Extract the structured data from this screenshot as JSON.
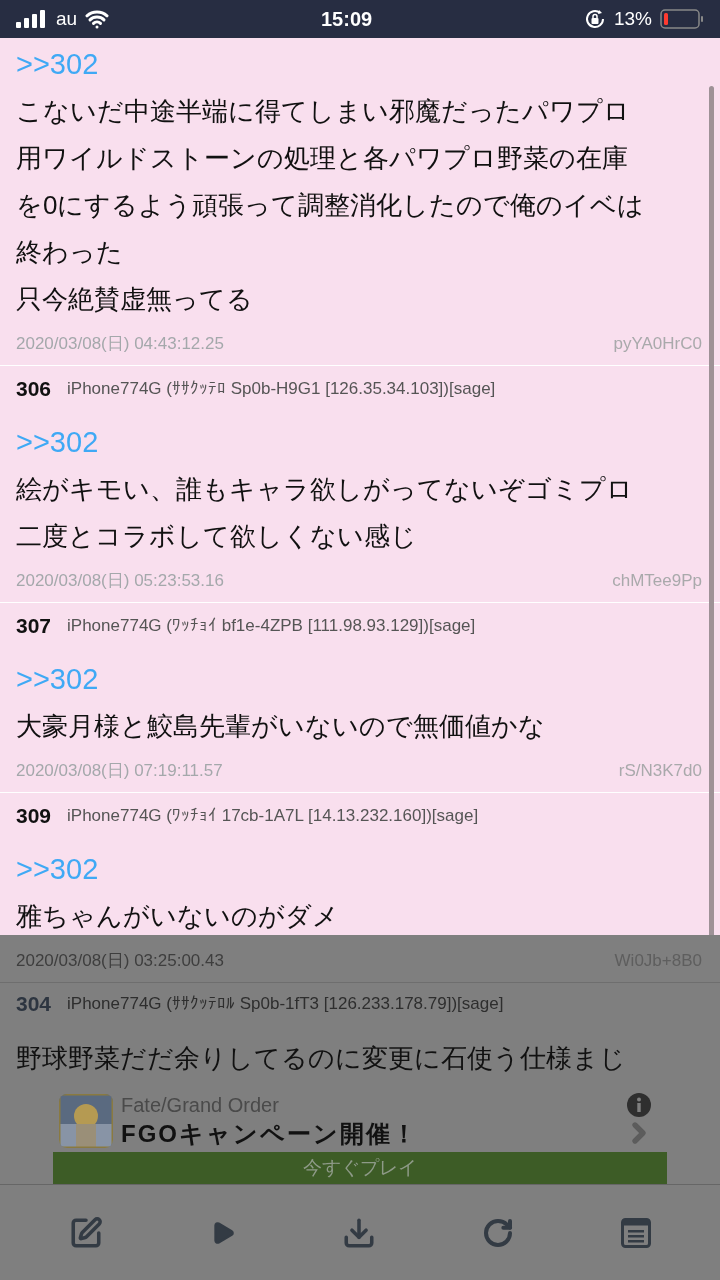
{
  "status_bar": {
    "carrier": "au",
    "time": "15:09",
    "battery": "13%"
  },
  "posts": [
    {
      "reply": ">>302",
      "lines": [
        "こないだ中途半端に得てしまい邪魔だったパワプロ",
        "用ワイルドストーンの処理と各パワプロ野菜の在庫",
        "を0にするよう頑張って調整消化したので俺のイベは",
        "終わった",
        "只今絶賛虚無ってる"
      ],
      "date": "2020/03/08(日) 04:43:12.25",
      "id": "pyYA0HrC0"
    },
    {
      "number": "306",
      "name": "iPhone774G (ｻｻｸｯﾃﾛ Sp0b-H9G1 [126.35.34.103])[sage]",
      "reply": ">>302",
      "lines": [
        "絵がキモい、誰もキャラ欲しがってないぞゴミプロ",
        "二度とコラボして欲しくない感じ"
      ],
      "date": "2020/03/08(日) 05:23:53.16",
      "id": "chMTee9Pp"
    },
    {
      "number": "307",
      "name": "iPhone774G (ﾜｯﾁｮｲ bf1e-4ZPB [111.98.93.129])[sage]",
      "reply": ">>302",
      "lines": [
        "大豪月様と鮫島先輩がいないので無価値かな"
      ],
      "date": "2020/03/08(日) 07:19:11.57",
      "id": "rS/N3K7d0"
    },
    {
      "number": "309",
      "name": "iPhone774G (ﾜｯﾁｮｲ 17cb-1A7L [14.13.232.160])[sage]",
      "reply": ">>302",
      "lines": [
        "雅ちゃんがいないのがダメ"
      ]
    }
  ],
  "dimmed": {
    "date": "2020/03/08(日) 03:25:00.43",
    "id": "Wi0Jb+8B0",
    "number": "304",
    "name": "iPhone774G (ｻｻｸｯﾃﾛﾙ Sp0b-1fT3 [126.233.178.79])[sage]",
    "body": "野球野菜だだ余りしてるのに変更に石使う仕様まじ"
  },
  "ad": {
    "app": "Fate/Grand Order",
    "title": "FGOキャンペーン開催！",
    "button": "今すぐプレイ"
  }
}
